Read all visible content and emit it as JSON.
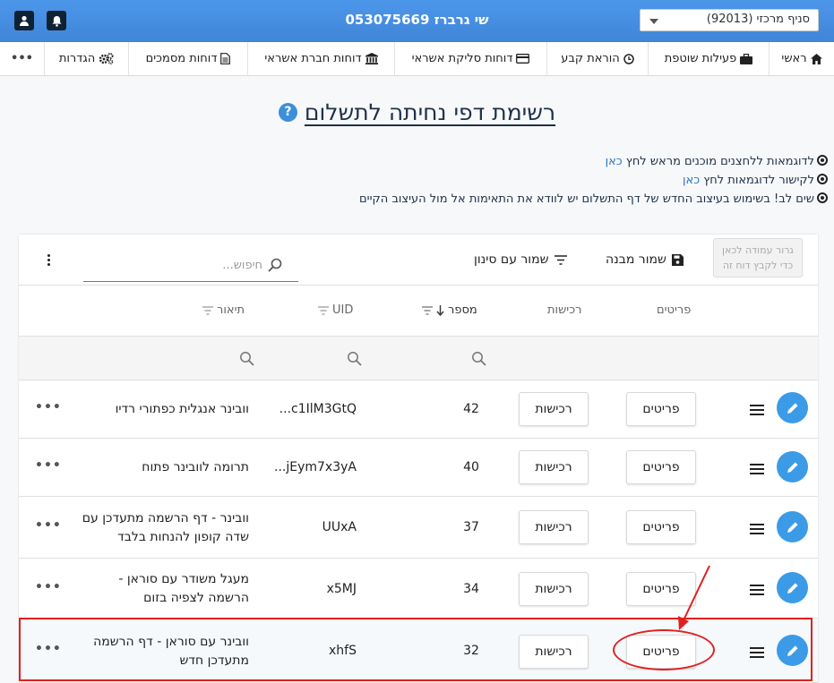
{
  "topbar": {
    "title": "שי גרברז 053075669",
    "branch_select": "סניף מרכזי (92013)",
    "user_icon": "user-icon",
    "bell_icon": "bell-icon"
  },
  "nav": {
    "home": "ראשי",
    "partner": "פעילות שוטפת",
    "standing_order": "הוראת קבע",
    "clearing_reports": "דוחות סליקת אשראי",
    "card_company_reports": "דוחות חברת אשראי",
    "doc_reports": "דוחות מסמכים",
    "settings": "הגדרות",
    "more": "•••"
  },
  "page": {
    "title": "רשימת דפי נחיתה לתשלום",
    "help_icon": "?"
  },
  "notes": [
    {
      "text": "לדוגמאות ללחצנים מוכנים מראש לחץ ",
      "link": "כאן"
    },
    {
      "text": "לקישור לדוגמאות לחץ ",
      "link": "כאן"
    },
    {
      "text": "שים לב! בשימוש בעיצוב החדש של דף התשלום יש לוודא את התאימות אל מול העיצוב הקיים",
      "link": ""
    }
  ],
  "toolbar": {
    "group_hint_1": "גרור עמודה לכאן",
    "group_hint_2": "כדי לקבץ דוח זה",
    "save_layout": "שמור מבנה",
    "save_filter": "שמור עם סינון",
    "search_placeholder": "חיפוש..."
  },
  "table": {
    "headers": {
      "details": "פריטים",
      "purchases": "רכישות",
      "number": "מספר",
      "uid": "UID",
      "description": "תיאור"
    },
    "rows": [
      {
        "details": "פריטים",
        "purchases": "רכישות",
        "number": "42",
        "uid": "...c1IlM3GtQ",
        "description": "וובינר אנגלית כפתורי רדיו"
      },
      {
        "details": "פריטים",
        "purchases": "רכישות",
        "number": "40",
        "uid": "...jEym7x3yA",
        "description": "תרומה לוובינר פתוח"
      },
      {
        "details": "פריטים",
        "purchases": "רכישות",
        "number": "37",
        "uid": "UUxA",
        "description": "וובינר - דף הרשמה מתעדכן עם שדה קופון להנחות בלבד"
      },
      {
        "details": "פריטים",
        "purchases": "רכישות",
        "number": "34",
        "uid": "x5MJ",
        "description": "מעגל משודר עם סוראן - הרשמה לצפיה בזום"
      },
      {
        "details": "פריטים",
        "purchases": "רכישות",
        "number": "32",
        "uid": "xhfS",
        "description": "וובינר עם סוראן - דף הרשמה מתעדכן חדש"
      }
    ]
  },
  "colors": {
    "topbar": "#4a90e2",
    "accent": "#3b9be6",
    "highlight": "#e02020"
  }
}
